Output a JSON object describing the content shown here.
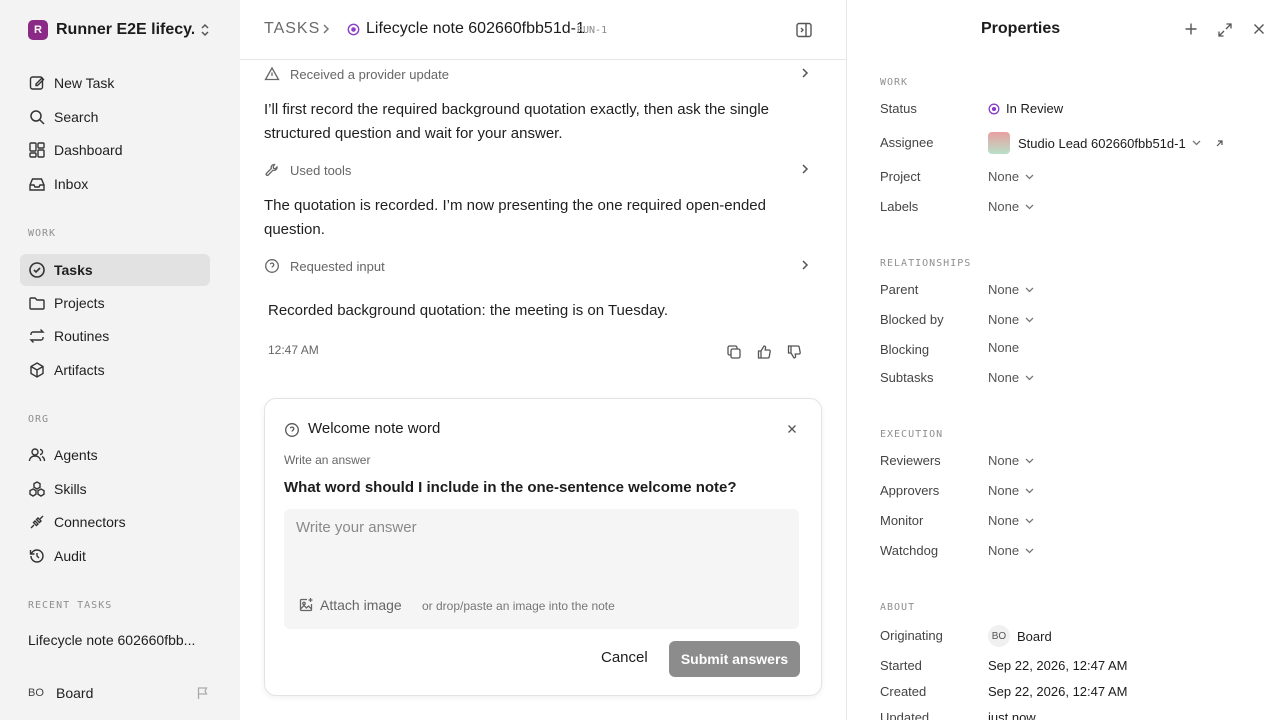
{
  "workspace": {
    "initial": "R",
    "name": "Runner E2E lifecy..."
  },
  "nav": {
    "new_task": "New Task",
    "search": "Search",
    "dashboard": "Dashboard",
    "inbox": "Inbox",
    "work_label": "WORK",
    "tasks": "Tasks",
    "projects": "Projects",
    "routines": "Routines",
    "artifacts": "Artifacts",
    "org_label": "ORG",
    "agents": "Agents",
    "skills": "Skills",
    "connectors": "Connectors",
    "audit": "Audit",
    "recent_label": "RECENT TASKS",
    "recent_task": "Lifecycle note 602660fbb..."
  },
  "user": {
    "initials": "BO",
    "name": "Board"
  },
  "header": {
    "root": "TASKS",
    "title": "Lifecycle note 602660fbb51d-1",
    "run": "RUN-1"
  },
  "thread": {
    "event1": "Received a provider update",
    "para1": "I’ll first record the required background quotation exactly, then ask the single structured question and wait for your answer.",
    "event2": "Used tools",
    "para2": "The quotation is recorded. I’m now presenting the one required open-ended question.",
    "event3": "Requested input",
    "recorded": "Recorded background quotation: the meeting is on Tuesday.",
    "timestamp": "12:47 AM"
  },
  "question_card": {
    "title": "Welcome note word",
    "subtitle": "Write an answer",
    "question": "What word should I include in the one-sentence welcome note?",
    "placeholder": "Write your answer",
    "attach": "Attach image",
    "attach_hint": "or drop/paste an image into the note",
    "cancel": "Cancel",
    "submit": "Submit answers"
  },
  "properties": {
    "title": "Properties",
    "work_label": "WORK",
    "status_label": "Status",
    "status_value": "In Review",
    "assignee_label": "Assignee",
    "assignee_value": "Studio Lead 602660fbb51d-1",
    "project_label": "Project",
    "project_value": "None",
    "labels_label": "Labels",
    "labels_value": "None",
    "relationships_label": "RELATIONSHIPS",
    "parent_label": "Parent",
    "parent_value": "None",
    "blocked_by_label": "Blocked by",
    "blocked_by_value": "None",
    "blocking_label": "Blocking",
    "blocking_value": "None",
    "subtasks_label": "Subtasks",
    "subtasks_value": "None",
    "execution_label": "EXECUTION",
    "reviewers_label": "Reviewers",
    "reviewers_value": "None",
    "approvers_label": "Approvers",
    "approvers_value": "None",
    "monitor_label": "Monitor",
    "monitor_value": "None",
    "watchdog_label": "Watchdog",
    "watchdog_value": "None",
    "about_label": "ABOUT",
    "originating_label": "Originating",
    "originating_initials": "BO",
    "originating_value": "Board",
    "started_label": "Started",
    "started_value": "Sep 22, 2026, 12:47 AM",
    "created_label": "Created",
    "created_value": "Sep 22, 2026, 12:47 AM",
    "updated_label": "Updated",
    "updated_value": "just now"
  },
  "colors": {
    "status_purple": "#8b3fc7",
    "workspace_logo": "#8a2a86",
    "submit_bg": "#8c8c8c"
  }
}
